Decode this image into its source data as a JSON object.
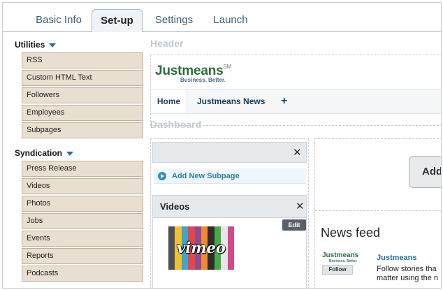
{
  "tabs": [
    {
      "label": "Basic Info",
      "active": false
    },
    {
      "label": "Set-up",
      "active": true
    },
    {
      "label": "Settings",
      "active": false
    },
    {
      "label": "Launch",
      "active": false
    }
  ],
  "sidebar": {
    "utilities": {
      "title": "Utilities",
      "items": [
        "RSS",
        "Custom HTML Text",
        "Followers",
        "Employees",
        "Subpages"
      ]
    },
    "syndication": {
      "title": "Syndication",
      "items": [
        "Press Release",
        "Videos",
        "Photos",
        "Jobs",
        "Events",
        "Reports",
        "Podcasts"
      ]
    }
  },
  "header_section": {
    "label": "Header",
    "logo_text": "Justmeans",
    "logo_tm": "SM",
    "logo_tagline": "Business. Better.",
    "nav": {
      "home": "Home",
      "news": "Justmeans News",
      "add": "+"
    }
  },
  "dashboard": {
    "label": "Dashboard",
    "close_glyph": "✕",
    "add_subpage": "Add New Subpage",
    "videos_title": "Videos",
    "edit_label": "Edit",
    "vimeo_text": "vimeo",
    "add_button": "Add",
    "news_feed_title": "News feed",
    "news_logo": "Justmeans",
    "follow_label": "Follow",
    "news_name": "Justmeans",
    "news_desc_line1": "Follow stories tha",
    "news_desc_line2": "matter using the n"
  },
  "colors": {
    "accent_blue": "#2b7fae",
    "item_bg": "#e8dfd1",
    "logo_green": "#2f6b3a"
  }
}
